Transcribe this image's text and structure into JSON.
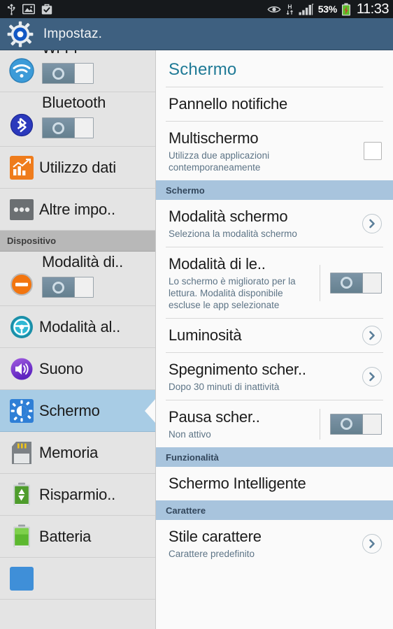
{
  "status_bar": {
    "left_icons": [
      "usb-icon",
      "image-icon",
      "briefcase-check-icon"
    ],
    "right_icons": [
      "smart-stay-eye-icon",
      "hspa-data-icon",
      "signal-bars-icon",
      "battery-charging-icon"
    ],
    "battery_percent": "53%",
    "clock": "11:33"
  },
  "title_bar": {
    "icon": "settings-gear-icon",
    "title": "Impostaz."
  },
  "sidebar": {
    "items": [
      {
        "id": "wifi",
        "label": "Wi-Fi",
        "icon": "wifi-icon",
        "has_toggle": true,
        "toggle_on": false
      },
      {
        "id": "bluetooth",
        "label": "Bluetooth",
        "icon": "bluetooth-icon",
        "has_toggle": true,
        "toggle_on": false
      },
      {
        "id": "utilizzo-dati",
        "label": "Utilizzo dati",
        "icon": "data-usage-icon",
        "has_toggle": false
      },
      {
        "id": "altre-impostazioni",
        "label": "Altre impo..",
        "icon": "more-dots-icon",
        "has_toggle": false
      }
    ],
    "section_device": "Dispositivo",
    "device_items": [
      {
        "id": "modalita-di-blocco",
        "label": "Modalità di..",
        "icon": "blocking-mode-icon",
        "has_toggle": true,
        "toggle_on": false
      },
      {
        "id": "modalita-alla-guida",
        "label": "Modalità al..",
        "icon": "driving-mode-icon",
        "has_toggle": false
      },
      {
        "id": "suono",
        "label": "Suono",
        "icon": "sound-speaker-icon",
        "has_toggle": false
      },
      {
        "id": "schermo",
        "label": "Schermo",
        "icon": "display-brightness-icon",
        "has_toggle": false,
        "selected": true
      },
      {
        "id": "memoria",
        "label": "Memoria",
        "icon": "sd-card-icon",
        "has_toggle": false
      },
      {
        "id": "risparmio-energetico",
        "label": "Risparmio..",
        "icon": "power-saving-icon",
        "has_toggle": false
      },
      {
        "id": "batteria",
        "label": "Batteria",
        "icon": "battery-icon",
        "has_toggle": false
      }
    ]
  },
  "panel": {
    "title": "Schermo",
    "rows": [
      {
        "id": "pannello-notifiche",
        "title": "Pannello notifiche",
        "sub": "",
        "control": "none"
      },
      {
        "id": "multischermo",
        "title": "Multischermo",
        "sub": "Utilizza due applicazioni contemporaneamente",
        "control": "checkbox",
        "checked": false
      }
    ],
    "section_schermo": "Schermo",
    "schermo_rows": [
      {
        "id": "modalita-schermo",
        "title": "Modalità schermo",
        "sub": "Seleziona la modalità schermo",
        "control": "chevron"
      },
      {
        "id": "modalita-di-lettura",
        "title": "Modalità di le..",
        "sub": "Lo schermo è migliorato per la lettura. Modalità disponibile escluse le app selezionate",
        "control": "toggle",
        "toggle_on": false
      },
      {
        "id": "luminosita",
        "title": "Luminosità",
        "sub": "",
        "control": "chevron"
      },
      {
        "id": "spegnimento-schermo",
        "title": "Spegnimento scher..",
        "sub": "Dopo 30 minuti di inattività",
        "control": "chevron"
      },
      {
        "id": "pausa-schermo",
        "title": "Pausa scher..",
        "sub": "Non attivo",
        "control": "toggle",
        "toggle_on": false
      }
    ],
    "section_funzionalita": "Funzionalità",
    "funzionalita_rows": [
      {
        "id": "schermo-intelligente",
        "title": "Schermo Intelligente",
        "sub": "",
        "control": "none"
      }
    ],
    "section_carattere": "Carattere",
    "carattere_rows": [
      {
        "id": "stile-carattere",
        "title": "Stile carattere",
        "sub": "Carattere predefinito",
        "control": "chevron"
      }
    ]
  },
  "colors": {
    "status_bar_bg": "#16191c",
    "title_bar_bg": "#3e6080",
    "sidebar_bg": "#e4e4e4",
    "selected_item_bg": "#a8cce5",
    "panel_bg": "#fafafa",
    "panel_title_text": "#1f7a96",
    "section_header_bg": "#a8c4dd",
    "sidebar_section_bg": "#b8b8b8",
    "subtitle_text": "#5d7486",
    "toggle_fill": "#6f8899"
  }
}
